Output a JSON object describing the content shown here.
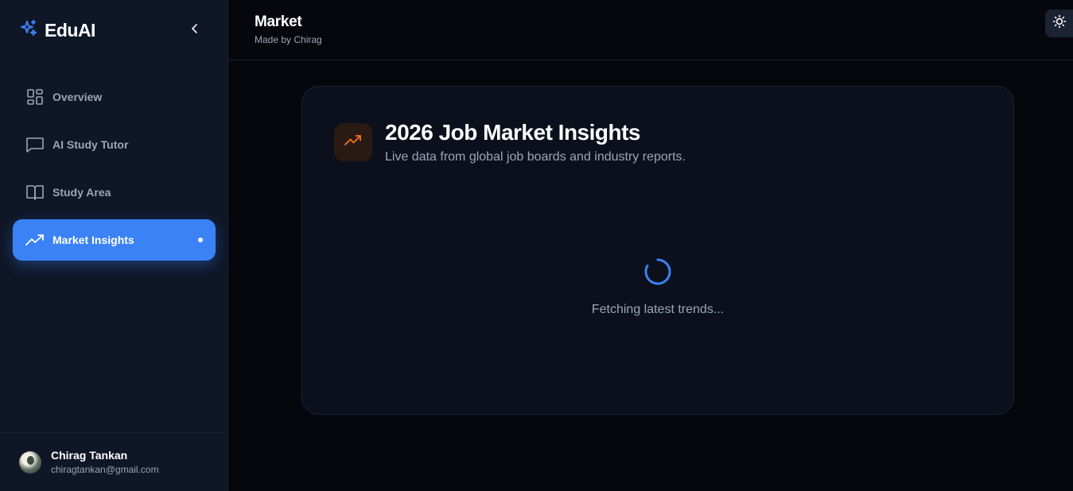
{
  "brand": {
    "name": "EduAI"
  },
  "sidebar": {
    "items": [
      {
        "label": "Overview",
        "icon": "dashboard-icon",
        "active": false
      },
      {
        "label": "AI Study Tutor",
        "icon": "chat-icon",
        "active": false
      },
      {
        "label": "Study Area",
        "icon": "book-icon",
        "active": false
      },
      {
        "label": "Market Insights",
        "icon": "trending-up-icon",
        "active": true
      }
    ]
  },
  "user": {
    "name": "Chirag Tankan",
    "email": "chiragtankan@gmail.com"
  },
  "header": {
    "title": "Market",
    "subtitle": "Made by Chirag"
  },
  "card": {
    "title": "2026 Job Market Insights",
    "subtitle": "Live data from global job boards and industry reports.",
    "loading_text": "Fetching latest trends..."
  },
  "colors": {
    "accent": "#3b82f6",
    "trend_icon": "#f97316",
    "sidebar_bg": "#0f1626",
    "page_bg": "#05070d"
  }
}
